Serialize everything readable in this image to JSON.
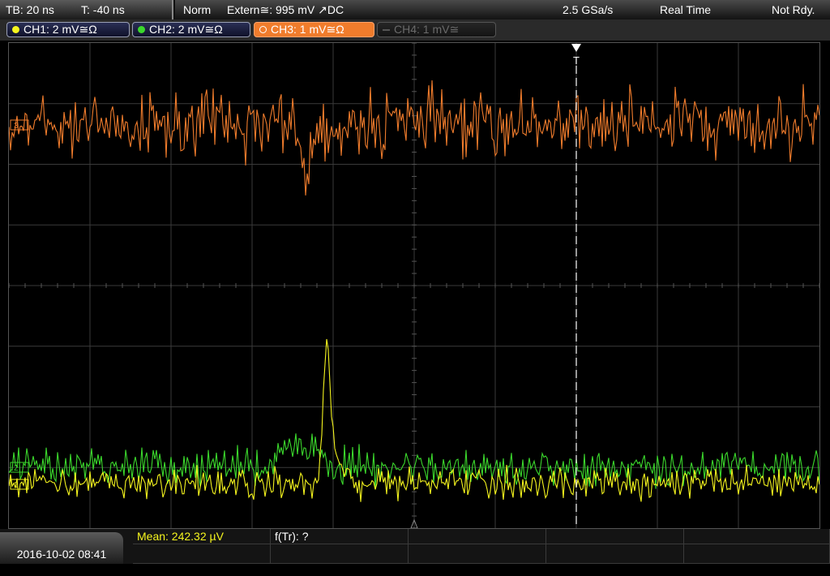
{
  "topbar": {
    "timebase": "TB: 20 ns",
    "trigger_time": "T: -40 ns",
    "trigger_mode": "Norm",
    "trigger_source": "Extern≅: 995 mV ↗DC",
    "sample_rate": "2.5 GSa/s",
    "acq_mode": "Real Time",
    "status": "Not Rdy."
  },
  "channels": [
    {
      "label": "CH1: 2 mV≅Ω",
      "color": "#f5f51e",
      "active": true
    },
    {
      "label": "CH2: 2 mV≅Ω",
      "color": "#3bd82c",
      "active": true
    },
    {
      "label": "CH3: 1 mV≅Ω",
      "color": "#f07c2c",
      "active": true,
      "selected": true
    },
    {
      "label": "CH4: 1 mV≅",
      "color": "#6a6a6a",
      "active": false
    }
  ],
  "markers": {
    "ch3": "3",
    "ch2": "2",
    "ch1": "1",
    "trigger": "T"
  },
  "measurements": {
    "mean": "Mean: 242.32 µV",
    "ftr": "f(Tr): ?"
  },
  "footer": {
    "datetime": "2016-10-02 08:41"
  }
}
